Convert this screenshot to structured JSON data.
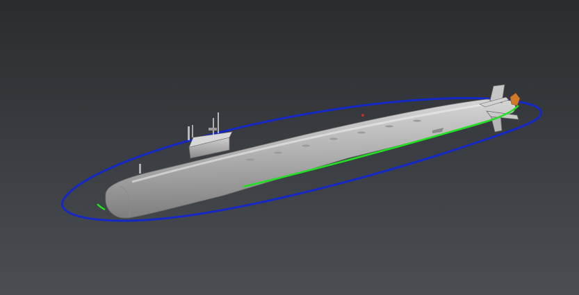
{
  "viewport": {
    "background_top": "#2a2c2f",
    "background_bottom": "#4a4e53"
  },
  "model": {
    "name": "submarine",
    "hull_light": "#dcdcdc",
    "hull_mid": "#b4b4b4",
    "hull_dark": "#7e7e7e",
    "waterline_color": "#22e022",
    "selection_ring_color": "#1428c8",
    "prop_color": "#d07a2a"
  }
}
